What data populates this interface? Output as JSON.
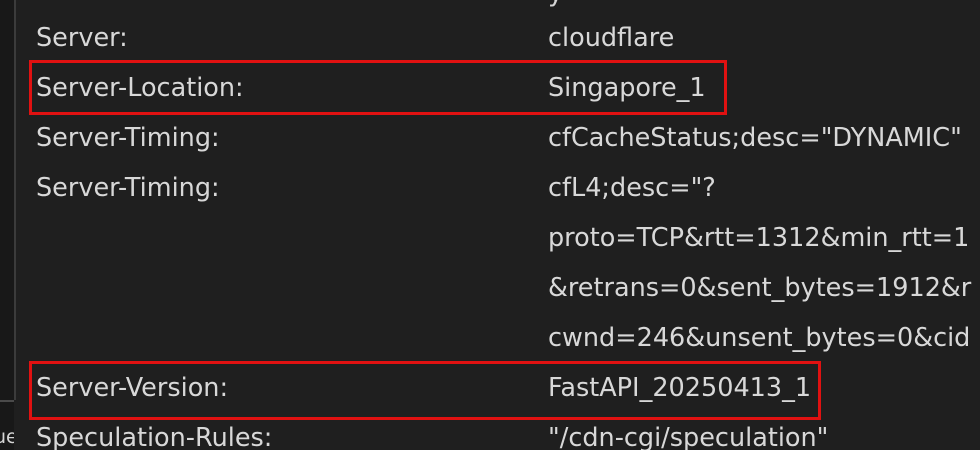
{
  "header_rows": [
    {
      "name": "Server:",
      "value": "cloudflare"
    },
    {
      "name": "Server-Location:",
      "value": "Singapore_1"
    },
    {
      "name": "Server-Timing:",
      "value": "cfCacheStatus;desc=\"DYNAMIC\""
    },
    {
      "name": "Server-Timing:",
      "value": "cfL4;desc=\"?"
    },
    {
      "name": "",
      "value": "proto=TCP&rtt=1312&min_rtt=1"
    },
    {
      "name": "",
      "value": "&retrans=0&sent_bytes=1912&r"
    },
    {
      "name": "",
      "value": "cwnd=246&unsent_bytes=0&cid"
    },
    {
      "name": "Server-Version:",
      "value": "FastAPI_20250413_1"
    },
    {
      "name": "Speculation-Rules:",
      "value": "\"/cdn-cgi/speculation\""
    }
  ],
  "top_partial_text": "y",
  "left_gutter_fragment": "ue",
  "colors": {
    "background": "#1f1f1f",
    "text": "#d8d8d8",
    "highlight": "#e01111"
  }
}
